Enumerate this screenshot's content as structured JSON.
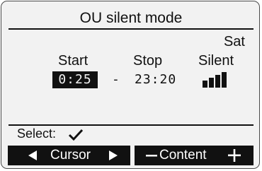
{
  "screen": {
    "title": "OU silent mode",
    "day": "Sat"
  },
  "schedule": {
    "headers": {
      "start": "Start",
      "stop": "Stop",
      "silent": "Silent"
    },
    "start_time": "0:25",
    "separator": "-",
    "stop_time": "23:20",
    "silent_level": {
      "filled_bars": 4,
      "total_bars": 4,
      "icon": "signal-bars-icon"
    }
  },
  "footer": {
    "select_label": "Select:",
    "select_icon": "checkmark-icon"
  },
  "buttons": {
    "cursor": {
      "label": "Cursor",
      "left_icon": "triangle-left-icon",
      "right_icon": "triangle-right-icon"
    },
    "content": {
      "label": "Content",
      "left_icon": "minus-icon",
      "right_icon": "plus-icon"
    }
  }
}
